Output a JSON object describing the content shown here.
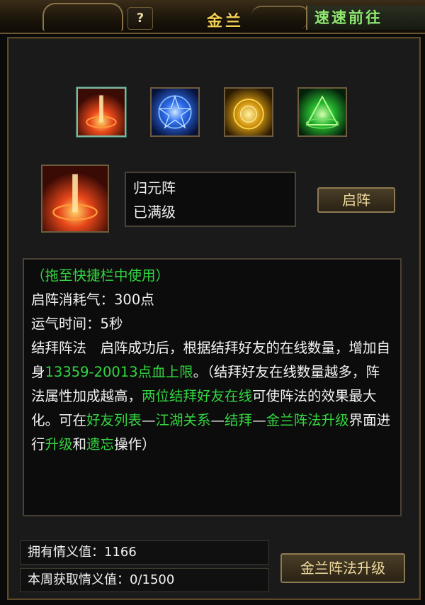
{
  "window": {
    "help_label": "?",
    "title": "金兰",
    "goto_label": "速速前往"
  },
  "formations": [
    {
      "icon": "red-flame-formation-icon",
      "selected": true
    },
    {
      "icon": "blue-star-formation-icon",
      "selected": false
    },
    {
      "icon": "gold-sun-formation-icon",
      "selected": false
    },
    {
      "icon": "green-triangle-formation-icon",
      "selected": false
    }
  ],
  "selected": {
    "name": "归元阵",
    "status": "已满级",
    "activate_label": "启阵"
  },
  "description": {
    "hint": "（拖至快捷栏中使用）",
    "cost": "启阵消耗气：300点",
    "duration": "运气时间：5秒",
    "p1": "结拜阵法　启阵成功后，根据结拜好友的在线数量，增加自身",
    "p1_green": "13359-20013点血上限",
    "p2": "。（结拜好友在线数量越多，阵法属性加成越高，",
    "p2_green": "两位结拜好友在线",
    "p3": "可使阵法的效果最大化。可在",
    "p3_g1": "好友列表",
    "sep1": "—",
    "p3_g2": "江湖关系",
    "sep2": "—",
    "p3_g3": "结拜",
    "sep3": "—",
    "p3_g4": "金兰阵法升级",
    "p4": "界面进行",
    "p4_g1": "升级",
    "p4_and": "和",
    "p4_g2": "遗忘",
    "p4_end": "操作）"
  },
  "stats": {
    "owned_label": "拥有情义值：1166",
    "weekly_label": "本周获取情义值：0/1500"
  },
  "upgrade_label": "金兰阵法升级",
  "colors": {
    "highlight_green": "#33d640",
    "title_gold": "#f3cf52",
    "goto_green": "#8fe870"
  }
}
